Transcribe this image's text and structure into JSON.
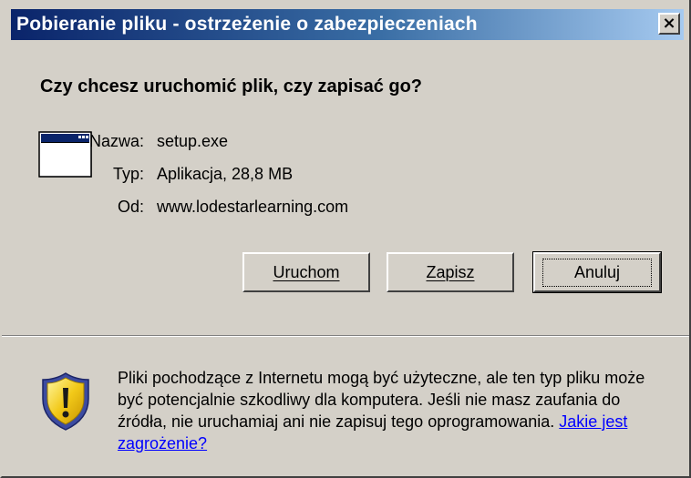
{
  "window": {
    "title": "Pobieranie pliku - ostrzeżenie o zabezpieczeniach",
    "close_glyph": "×"
  },
  "dialog": {
    "question": "Czy chcesz uruchomić plik, czy zapisać go?",
    "file": {
      "icon": "application-window-icon",
      "name_label": "Nazwa:",
      "name_value": "setup.exe",
      "type_label": "Typ:",
      "type_value": "Aplikacja, 28,8 MB",
      "from_label": "Od:",
      "from_value": "www.lodestarlearning.com"
    },
    "buttons": {
      "run_label": "Uruchom",
      "save_label": "Zapisz",
      "cancel_label": "Anuluj"
    },
    "warning": {
      "icon": "shield-warning-icon",
      "text": "Pliki pochodzące z Internetu mogą być użyteczne, ale ten typ pliku może być potencjalnie szkodliwy dla komputera. Jeśli nie masz zaufania do źródła, nie uruchamiaj ani nie zapisuj tego oprogramowania.",
      "link_text": "Jakie jest zagrożenie?"
    }
  },
  "colors": {
    "face": "#d4d0c8",
    "title_start": "#0a246a",
    "title_end": "#a6caf0",
    "link": "#0000ff"
  }
}
